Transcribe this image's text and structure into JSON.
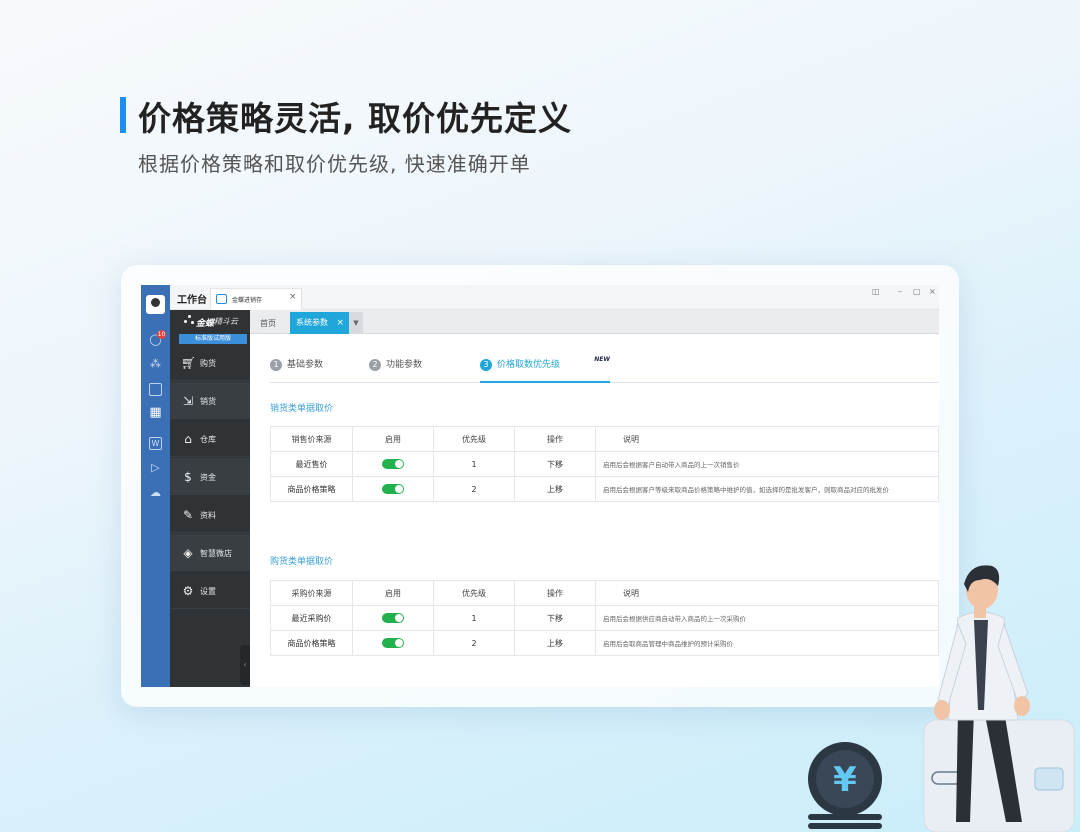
{
  "hero": {
    "title": "价格策略灵活, 取价优先定义",
    "subtitle": "根据价格策略和取价优先级, 快速准确开单"
  },
  "colors": {
    "accent": "#1f8ef1",
    "nav_bg": "#2f3336",
    "rail_bg": "#3b6fb6",
    "active_tab": "#1fa7d9",
    "toggle_on": "#22b14c"
  },
  "app": {
    "notification_count": "10",
    "workbench_label": "工作台",
    "doc_tab_label": "金蝶进销存",
    "brand_name": "金蝶",
    "brand_sub": "精斗云",
    "edition": "标准版试用版",
    "window_controls": [
      "◫",
      "–",
      "▢",
      "×"
    ]
  },
  "nav": {
    "items": [
      {
        "label": "购货",
        "icon": "cart-icon"
      },
      {
        "label": "销货",
        "icon": "sales-icon"
      },
      {
        "label": "仓库",
        "icon": "warehouse-icon"
      },
      {
        "label": "资金",
        "icon": "money-icon"
      },
      {
        "label": "资料",
        "icon": "pen-icon"
      },
      {
        "label": "智慧微店",
        "icon": "shop-icon"
      },
      {
        "label": "设置",
        "icon": "gear-icon"
      }
    ]
  },
  "tabs": {
    "home": "首页",
    "system_params": "系统参数"
  },
  "steps": [
    {
      "num": "1",
      "label": "基础参数"
    },
    {
      "num": "2",
      "label": "功能参数"
    },
    {
      "num": "3",
      "label": "价格取数优先级",
      "tag": "NEW"
    }
  ],
  "sales_section": {
    "title": "销货类单据取价",
    "headers": [
      "销售价来源",
      "启用",
      "优先级",
      "操作",
      "说明"
    ],
    "rows": [
      {
        "source": "最近售价",
        "enabled": true,
        "priority": "1",
        "action": "下移",
        "desc": "启用后会根据客户自动带入商品的上一次销售价"
      },
      {
        "source": "商品价格策略",
        "enabled": true,
        "priority": "2",
        "action": "上移",
        "desc": "启用后会根据客户等级来取商品价格策略中维护的值，如选择的是批发客户，则取商品对应的批发价"
      }
    ]
  },
  "purchase_section": {
    "title": "购货类单据取价",
    "headers": [
      "采购价来源",
      "启用",
      "优先级",
      "操作",
      "说明"
    ],
    "rows": [
      {
        "source": "最近采购价",
        "enabled": true,
        "priority": "1",
        "action": "下移",
        "desc": "启用后会根据供应商自动带入商品的上一次采购价"
      },
      {
        "source": "商品价格策略",
        "enabled": true,
        "priority": "2",
        "action": "上移",
        "desc": "启用后会取商品管理中商品维护的预计采购价"
      }
    ]
  },
  "coin_symbol": "¥"
}
